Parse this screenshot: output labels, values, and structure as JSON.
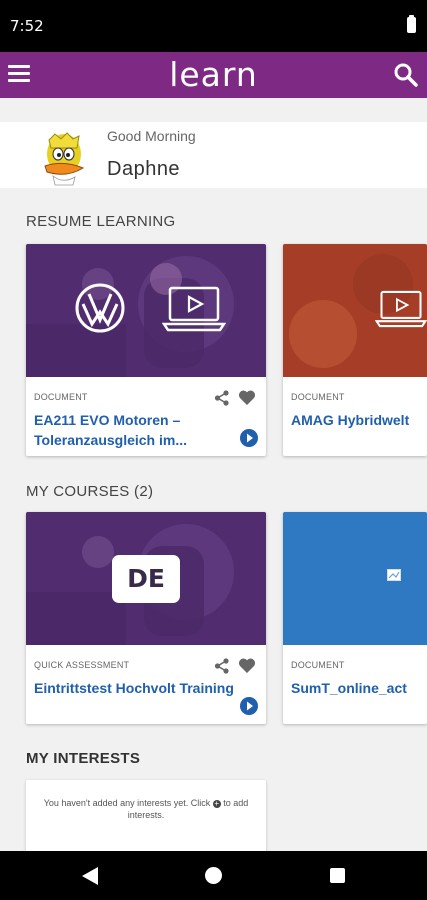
{
  "status_bar": {
    "time": "7:52"
  },
  "app_bar": {
    "title": "learn"
  },
  "greeting": {
    "label": "Good Morning",
    "name": "Daphne"
  },
  "resume_learning": {
    "title": "RESUME LEARNING",
    "cards": [
      {
        "type": "DOCUMENT",
        "title": "EA211 EVO Motoren – Toleranzausgleich im...",
        "overlay_icon": "laptop-play-icon",
        "logo": "vw-logo"
      },
      {
        "type": "DOCUMENT",
        "title": "AMAG Hybridwelt",
        "overlay_icon": "laptop-play-icon"
      }
    ]
  },
  "my_courses": {
    "title": "MY COURSES (2)",
    "cards": [
      {
        "type": "QUICK ASSESSMENT",
        "title": "Eintrittstest Hochvolt Training",
        "badge": "DE"
      },
      {
        "type": "DOCUMENT",
        "title": "SumT_online_act",
        "overlay_icon": "broken-image-icon"
      }
    ]
  },
  "my_interests": {
    "title": "MY INTERESTS",
    "empty_text_before": "You haven't added any interests yet. Click",
    "empty_text_after": "to add interests."
  },
  "colors": {
    "brand": "#7e2a85",
    "link": "#1f5fae",
    "course_blue": "#2f79c2",
    "card_purple": "#5b2f7d",
    "card_orange": "#b5442a"
  }
}
